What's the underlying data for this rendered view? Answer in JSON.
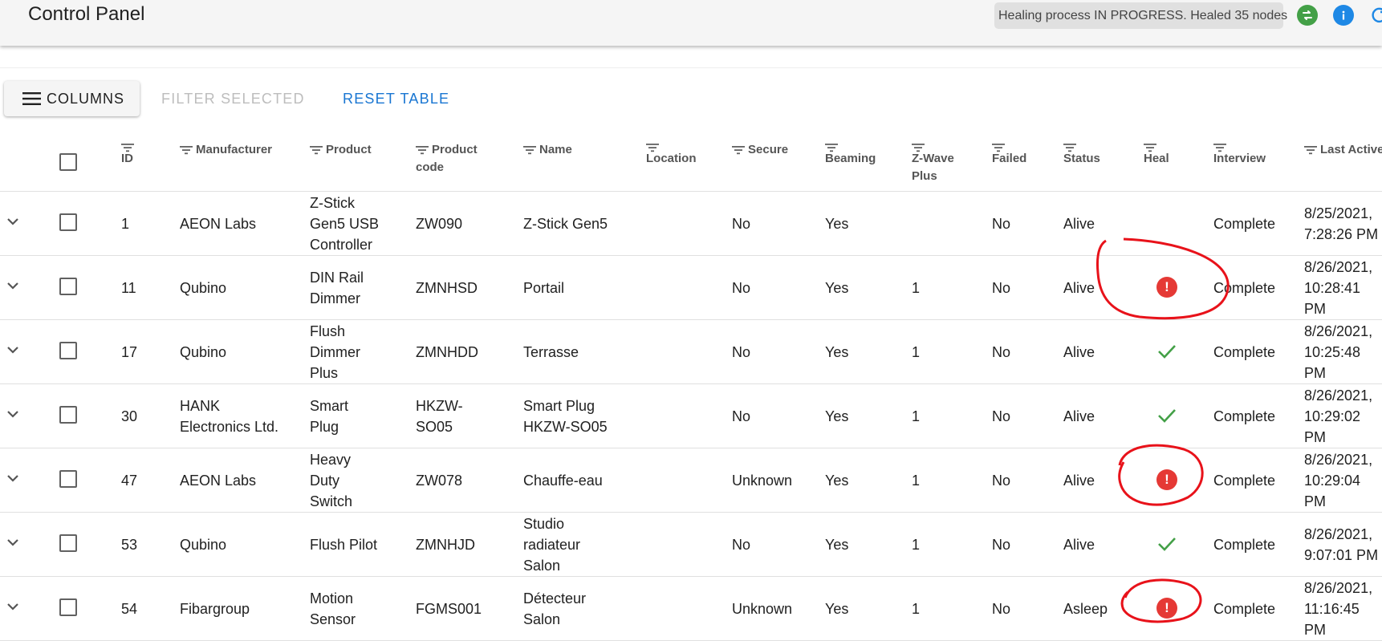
{
  "app": {
    "title": "Control Panel",
    "status_text": "Healing process IN PROGRESS. Healed 35 nodes",
    "icons": [
      "swap-icon",
      "info-icon",
      "refresh-icon"
    ],
    "colors": {
      "ok": "#43a047",
      "info": "#1e88e5",
      "error": "#e53935",
      "link": "#1976d2",
      "annotation": "#e8121a"
    }
  },
  "toolbar": {
    "columns_label": "COLUMNS",
    "filter_label": "FILTER SELECTED",
    "reset_label": "RESET TABLE"
  },
  "table": {
    "headers": {
      "id": "ID",
      "manufacturer": "Manufacturer",
      "product": "Product",
      "product_code": "Product code",
      "name": "Name",
      "location": "Location",
      "secure": "Secure",
      "beaming": "Beaming",
      "zwave_plus": "Z-Wave Plus",
      "failed": "Failed",
      "status": "Status",
      "heal": "Heal",
      "interview": "Interview",
      "last_active": "Last Active"
    },
    "rows": [
      {
        "id": "1",
        "manufacturer": "AEON Labs",
        "product": "Z-Stick Gen5 USB Controller",
        "product_code": "ZW090",
        "name": "Z-Stick Gen5",
        "location": "",
        "secure": "No",
        "beaming": "Yes",
        "zwave_plus": "",
        "failed": "No",
        "status": "Alive",
        "heal": "none",
        "interview": "Complete",
        "last_active": "8/25/2021, 7:28:26 PM"
      },
      {
        "id": "11",
        "manufacturer": "Qubino",
        "product": "DIN Rail Dimmer",
        "product_code": "ZMNHSD",
        "name": "Portail",
        "location": "",
        "secure": "No",
        "beaming": "Yes",
        "zwave_plus": "1",
        "failed": "No",
        "status": "Alive",
        "heal": "error",
        "interview": "Complete",
        "last_active": "8/26/2021, 10:28:41 PM"
      },
      {
        "id": "17",
        "manufacturer": "Qubino",
        "product": "Flush Dimmer Plus",
        "product_code": "ZMNHDD",
        "name": "Terrasse",
        "location": "",
        "secure": "No",
        "beaming": "Yes",
        "zwave_plus": "1",
        "failed": "No",
        "status": "Alive",
        "heal": "ok",
        "interview": "Complete",
        "last_active": "8/26/2021, 10:25:48 PM"
      },
      {
        "id": "30",
        "manufacturer": "HANK Electronics Ltd.",
        "product": "Smart Plug",
        "product_code": "HKZW-SO05",
        "name": "Smart Plug HKZW-SO05",
        "location": "",
        "secure": "No",
        "beaming": "Yes",
        "zwave_plus": "1",
        "failed": "No",
        "status": "Alive",
        "heal": "ok",
        "interview": "Complete",
        "last_active": "8/26/2021, 10:29:02 PM"
      },
      {
        "id": "47",
        "manufacturer": "AEON Labs",
        "product": "Heavy Duty Switch",
        "product_code": "ZW078",
        "name": "Chauffe-eau",
        "location": "",
        "secure": "Unknown",
        "beaming": "Yes",
        "zwave_plus": "1",
        "failed": "No",
        "status": "Alive",
        "heal": "error",
        "interview": "Complete",
        "last_active": "8/26/2021, 10:29:04 PM"
      },
      {
        "id": "53",
        "manufacturer": "Qubino",
        "product": "Flush Pilot",
        "product_code": "ZMNHJD",
        "name": "Studio radiateur Salon",
        "location": "",
        "secure": "No",
        "beaming": "Yes",
        "zwave_plus": "1",
        "failed": "No",
        "status": "Alive",
        "heal": "ok",
        "interview": "Complete",
        "last_active": "8/26/2021, 9:07:01 PM"
      },
      {
        "id": "54",
        "manufacturer": "Fibargroup",
        "product": "Motion Sensor",
        "product_code": "FGMS001",
        "name": "Détecteur Salon",
        "location": "",
        "secure": "Unknown",
        "beaming": "Yes",
        "zwave_plus": "1",
        "failed": "No",
        "status": "Asleep",
        "heal": "error",
        "interview": "Complete",
        "last_active": "8/26/2021, 11:16:45 PM"
      }
    ]
  }
}
